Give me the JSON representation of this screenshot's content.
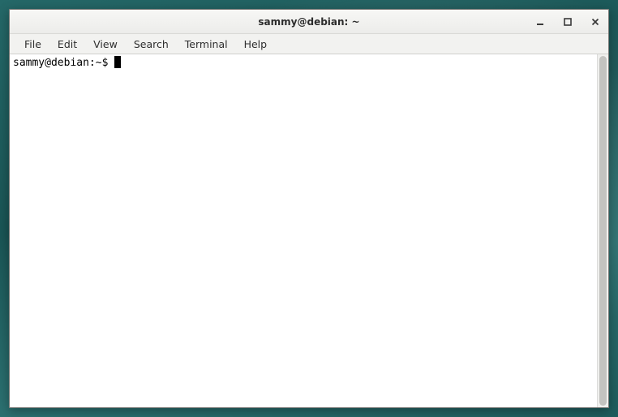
{
  "window": {
    "title": "sammy@debian: ~"
  },
  "menubar": {
    "items": [
      {
        "label": "File"
      },
      {
        "label": "Edit"
      },
      {
        "label": "View"
      },
      {
        "label": "Search"
      },
      {
        "label": "Terminal"
      },
      {
        "label": "Help"
      }
    ]
  },
  "terminal": {
    "prompt": "sammy@debian:~$ "
  }
}
